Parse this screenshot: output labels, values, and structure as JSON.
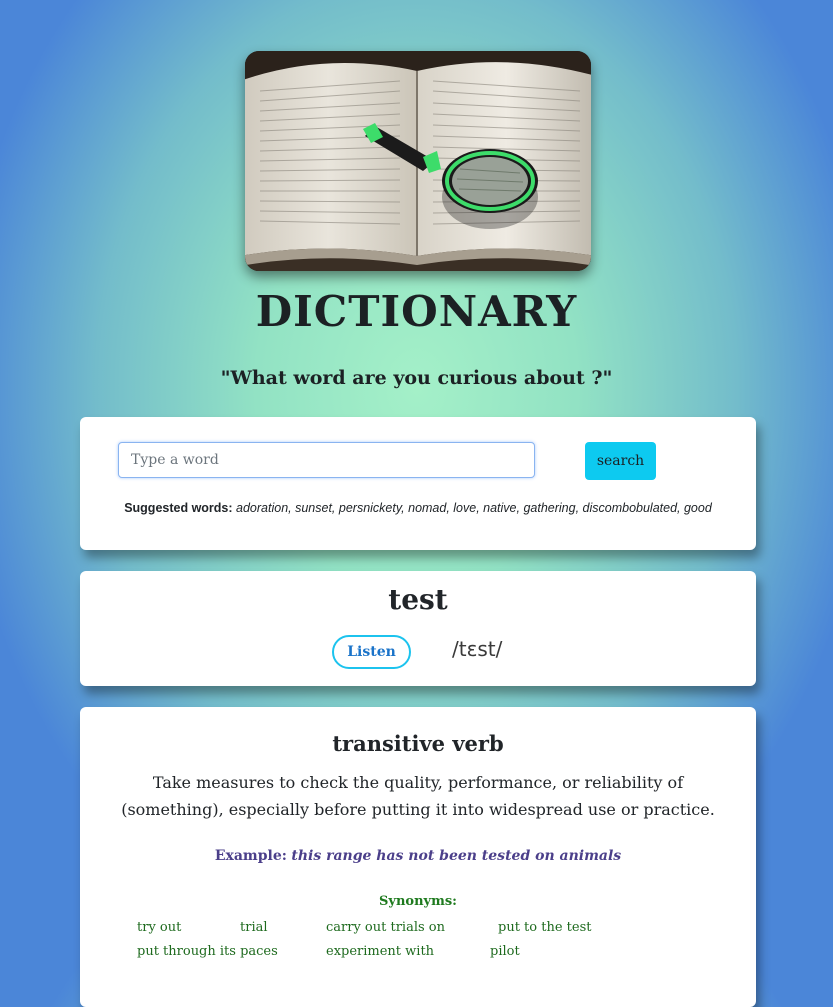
{
  "header": {
    "title": "DICTIONARY",
    "tagline": "\"What word are you curious about ?\""
  },
  "search": {
    "placeholder": "Type a word",
    "button_label": "search",
    "suggested_label": "Suggested words:",
    "suggested_words": "adoration, sunset, persnickety, nomad, love, native, gathering, discombobulated, good"
  },
  "result": {
    "word": "test",
    "listen_label": "Listen",
    "phonetic": "/tɛst/"
  },
  "meaning": {
    "part_of_speech": "transitive verb",
    "definition": "Take measures to check the quality, performance, or reliability of (something), especially before putting it into widespread use or practice.",
    "example_label": "Example:",
    "example_text": "this range has not been tested on animals",
    "synonyms_label": "Synonyms:",
    "synonyms": [
      "try out",
      "trial",
      "carry out trials on",
      "put to the test",
      "put through its paces",
      "experiment with",
      "pilot"
    ]
  },
  "icons": {
    "hero": "book-magnifier-image"
  }
}
